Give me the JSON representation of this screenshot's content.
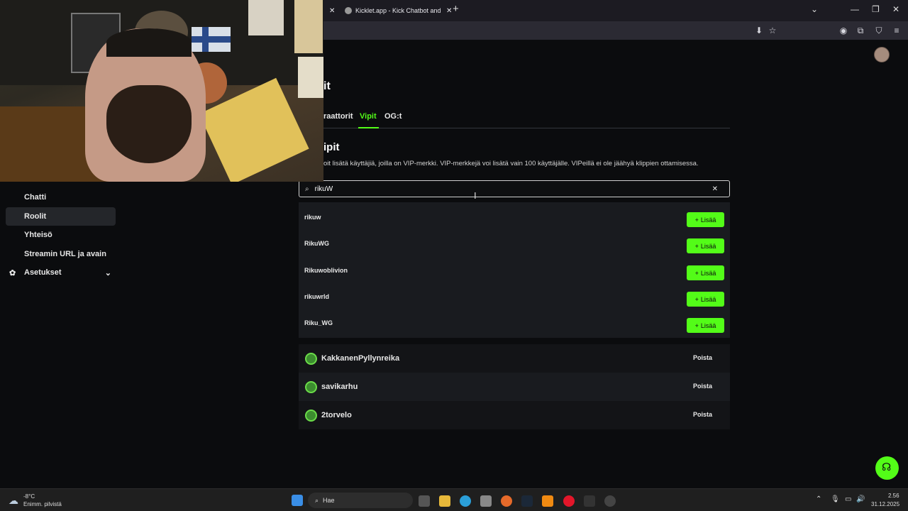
{
  "browser": {
    "tabs": [
      {
        "label": "",
        "active": false
      },
      {
        "label": "Kicklet.app - Kick Chatbot and (",
        "active": true
      }
    ],
    "new_tab": "+",
    "window_controls": {
      "dropdown": "⌄",
      "minimize": "—",
      "maximize": "❐",
      "close": "✕"
    }
  },
  "sidebar": {
    "items": [
      {
        "label": "Chatti",
        "active": false
      },
      {
        "label": "Roolit",
        "active": true
      },
      {
        "label": "Yhteisö",
        "active": false
      },
      {
        "label": "Streamin URL ja avain",
        "active": false
      },
      {
        "label": "Asetukset",
        "active": false,
        "icon": "gear-icon",
        "expandable": true
      }
    ]
  },
  "page": {
    "title_partial": "it",
    "tabs": [
      {
        "label": "raattorit",
        "active": false
      },
      {
        "label": "Vipit",
        "active": true
      },
      {
        "label": "OG:t",
        "active": false
      }
    ],
    "section_title": "ipit",
    "section_description": "oit lisätä käyttäjiä, joilla on VIP-merkki. VIP-merkkejä voi lisätä vain 100 käyttäjälle. VIPeillä ei ole jäähyä klippien ottamisessa."
  },
  "search": {
    "value": "rikuW",
    "clear_icon": "✕"
  },
  "search_results": [
    {
      "name": "rikuw",
      "button": "Lisää"
    },
    {
      "name": "RikuWG",
      "button": "Lisää"
    },
    {
      "name": "Rikuwoblivion",
      "button": "Lisää"
    },
    {
      "name": "rikuwrld",
      "button": "Lisää"
    },
    {
      "name": "Riku_WG",
      "button": "Lisää"
    }
  ],
  "vips": [
    {
      "name": "KakkanenPyllynreika",
      "button": "Poista"
    },
    {
      "name": "savikarhu",
      "button": "Poista"
    },
    {
      "name": "2torvelo",
      "button": "Poista"
    }
  ],
  "taskbar": {
    "weather_temp": "-8°C",
    "weather_desc": "Enimm. pilvistä",
    "search_placeholder": "Hae",
    "time": "2.56",
    "date": "31.12.2025"
  },
  "colors": {
    "accent": "#53fc18",
    "background": "#0b0c0e",
    "panel": "#191b1f"
  }
}
